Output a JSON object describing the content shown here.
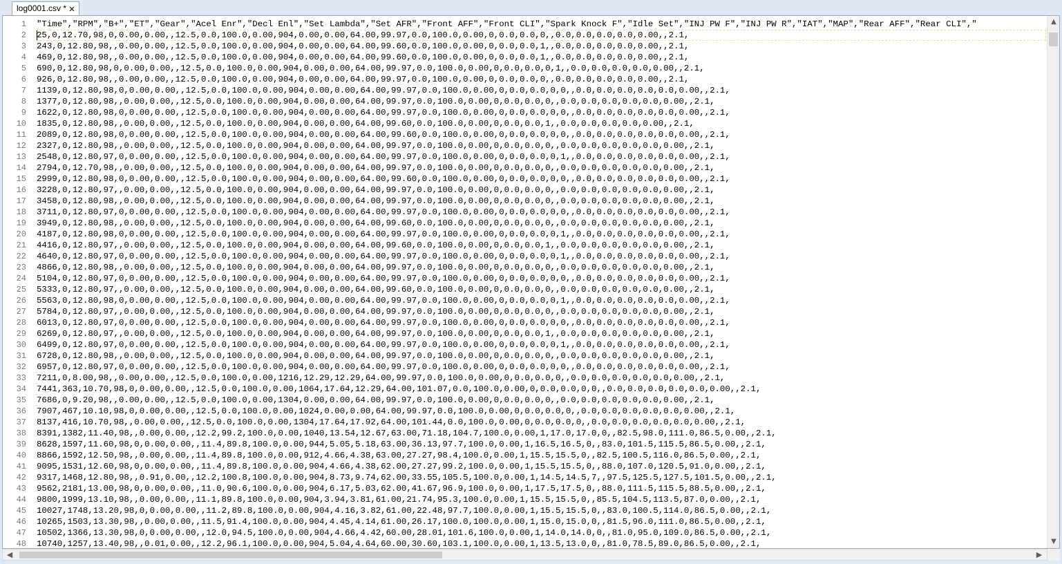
{
  "tab": {
    "title": "log0001.csv *",
    "close": "✕"
  },
  "colors": {
    "frame": "#dfe9f5",
    "editor_bg": "#ffffff",
    "line_number": "#7a7a7a",
    "current_line_border": "#f5e08a"
  },
  "icons": {
    "close": "close-icon",
    "up": "arrow-up-icon",
    "down": "arrow-down-icon",
    "left": "arrow-left-icon",
    "right": "arrow-right-icon"
  },
  "arrows": {
    "up": "▲",
    "down": "▼",
    "left": "◀",
    "right": "▶"
  },
  "lines": [
    {
      "n": "1",
      "t": "\"Time\",\"RPM\",\"B+\",\"ET\",\"Gear\",\"Acel Enr\",\"Decl Enl\",\"Set Lambda\",\"Set AFR\",\"Front AFF\",\"Front CLI\",\"Spark Knock F\",\"Idle Set\",\"INJ PW F\",\"INJ PW R\",\"IAT\",\"MAP\",\"Rear AFF\",\"Rear CLI\",\""
    },
    {
      "n": "2",
      "t": "25,0,12.70,98,0,0.00,0.00,,12.5,0.0,100.0,0.00,904,0.00,0.00,64.00,99.97,0.0,100.0,0.00,0,0.0,0.0,0,,0.0,0.0,0.0,0.0,0.00,,2.1,"
    },
    {
      "n": "3",
      "t": "243,0,12.80,98,,0.00,0.00,,12.5,0.0,100.0,0.00,904,0.00,0.00,64.00,99.60,0.0,100.0,0.00,0,0.0,0.0,1,,0.0,0.0,0.0,0.0,0.00,,2.1,"
    },
    {
      "n": "4",
      "t": "469,0,12.80,98,,0.00,0.00,,12.5,0.0,100.0,0.00,904,0.00,0.00,64.00,99.60,0.0,100.0,0.00,0,0.0,0.0,1,,0.0,0.0,0.0,0.0,0.00,,2.1,"
    },
    {
      "n": "5",
      "t": "690,0,12.80,98,0,0.00,0.00,,12.5,0.0,100.0,0.00,904,0.00,0.00,64.00,99.97,0.0,100.0,0.00,0,0.0,0.0,0,1,,0.0,0.0,0.0,0.0,0.00,,2.1,"
    },
    {
      "n": "6",
      "t": "926,0,12.80,98,,0.00,0.00,,12.5,0.0,100.0,0.00,904,0.00,0.00,64.00,99.97,0.0,100.0,0.00,0,0.0,0.0,0,,0.0,0.0,0.0,0.0,0.00,,2.1,"
    },
    {
      "n": "7",
      "t": "1139,0,12.80,98,0,0.00,0.00,,12.5,0.0,100.0,0.00,904,0.00,0.00,64.00,99.97,0.0,100.0,0.00,0,0.0,0.0,0,0,,0.0,0.0,0.0,0.0,0.0,0.00,,2.1,"
    },
    {
      "n": "8",
      "t": "1377,0,12.80,98,,0.00,0.00,,12.5,0.0,100.0,0.00,904,0.00,0.00,64.00,99.97,0.0,100.0,0.00,0,0.0,0.0,0,,0.0,0.0,0.0,0.0,0.0,0.00,,2.1,"
    },
    {
      "n": "9",
      "t": "1622,0,12.80,98,0,0.00,0.00,,12.5,0.0,100.0,0.00,904,0.00,0.00,64.00,99.97,0.0,100.0,0.00,0,0.0,0.0,0,0,,0.0,0.0,0.0,0.0,0.0,0.00,,2.1,"
    },
    {
      "n": "10",
      "t": "1835,0,12.80,98,,0.00,0.00,,12.5,0.0,100.0,0.00,904,0.00,0.00,64.00,99.60,0.0,100.0,0.00,0,0.0,0.0,1,,0.0,0.0,0.0,0.0,0.00,,2.1,"
    },
    {
      "n": "11",
      "t": "2089,0,12.80,98,0,0.00,0.00,,12.5,0.0,100.0,0.00,904,0.00,0.00,64.00,99.60,0.0,100.0,0.00,0,0.0,0.0,0,0,,0.0,0.0,0.0,0.0,0.0,0.00,,2.1,"
    },
    {
      "n": "12",
      "t": "2327,0,12.80,98,,0.00,0.00,,12.5,0.0,100.0,0.00,904,0.00,0.00,64.00,99.97,0.0,100.0,0.00,0,0.0,0.0,0,,0.0,0.0,0.0,0.0,0.0,0.00,,2.1,"
    },
    {
      "n": "13",
      "t": "2548,0,12.80,97,0,0.00,0.00,,12.5,0.0,100.0,0.00,904,0.00,0.00,64.00,99.97,0.0,100.0,0.00,0,0.0,0.0,0,1,,0.0,0.0,0.0,0.0,0.0,0.00,,2.1,"
    },
    {
      "n": "14",
      "t": "2794,0,12.70,98,,0.00,0.00,,12.5,0.0,100.0,0.00,904,0.00,0.00,64.00,99.97,0.0,100.0,0.00,0,0.0,0.0,0,,0.0,0.0,0.0,0.0,0.0,0.00,,2.1,"
    },
    {
      "n": "15",
      "t": "2999,0,12.80,98,0,0.00,0.00,,12.5,0.0,100.0,0.00,904,0.00,0.00,64.00,99.60,0.0,100.0,0.00,0,0.0,0.0,0,0,,0.0,0.0,0.0,0.0,0.0,0.00,,2.1,"
    },
    {
      "n": "16",
      "t": "3228,0,12.80,97,,0.00,0.00,,12.5,0.0,100.0,0.00,904,0.00,0.00,64.00,99.97,0.0,100.0,0.00,0,0.0,0.0,0,,0.0,0.0,0.0,0.0,0.0,0.00,,2.1,"
    },
    {
      "n": "17",
      "t": "3458,0,12.80,98,,0.00,0.00,,12.5,0.0,100.0,0.00,904,0.00,0.00,64.00,99.97,0.0,100.0,0.00,0,0.0,0.0,0,,0.0,0.0,0.0,0.0,0.0,0.00,,2.1,"
    },
    {
      "n": "18",
      "t": "3711,0,12.80,97,0,0.00,0.00,,12.5,0.0,100.0,0.00,904,0.00,0.00,64.00,99.97,0.0,100.0,0.00,0,0.0,0.0,0,0,,0.0,0.0,0.0,0.0,0.0,0.00,,2.1,"
    },
    {
      "n": "19",
      "t": "3949,0,12.80,98,,0.00,0.00,,12.5,0.0,100.0,0.00,904,0.00,0.00,64.00,99.60,0.0,100.0,0.00,0,0.0,0.0,0,,0.0,0.0,0.0,0.0,0.0,0.00,,2.1,"
    },
    {
      "n": "20",
      "t": "4187,0,12.80,98,0,0.00,0.00,,12.5,0.0,100.0,0.00,904,0.00,0.00,64.00,99.97,0.0,100.0,0.00,0,0.0,0.0,0,1,,0.0,0.0,0.0,0.0,0.0,0.00,,2.1,"
    },
    {
      "n": "21",
      "t": "4416,0,12.80,97,,0.00,0.00,,12.5,0.0,100.0,0.00,904,0.00,0.00,64.00,99.60,0.0,100.0,0.00,0,0.0,0.0,1,,0.0,0.0,0.0,0.0,0.0,0.00,,2.1,"
    },
    {
      "n": "22",
      "t": "4640,0,12.80,97,0,0.00,0.00,,12.5,0.0,100.0,0.00,904,0.00,0.00,64.00,99.97,0.0,100.0,0.00,0,0.0,0.0,0,1,,0.0,0.0,0.0,0.0,0.0,0.00,,2.1,"
    },
    {
      "n": "23",
      "t": "4866,0,12.80,98,,0.00,0.00,,12.5,0.0,100.0,0.00,904,0.00,0.00,64.00,99.97,0.0,100.0,0.00,0,0.0,0.0,0,,0.0,0.0,0.0,0.0,0.0,0.00,,2.1,"
    },
    {
      "n": "24",
      "t": "5104,0,12.80,97,0,0.00,0.00,,12.5,0.0,100.0,0.00,904,0.00,0.00,64.00,99.97,0.0,100.0,0.00,0,0.0,0.0,0,0,,0.0,0.0,0.0,0.0,0.0,0.00,,2.1,"
    },
    {
      "n": "25",
      "t": "5333,0,12.80,97,,0.00,0.00,,12.5,0.0,100.0,0.00,904,0.00,0.00,64.00,99.60,0.0,100.0,0.00,0,0.0,0.0,0,,0.0,0.0,0.0,0.0,0.0,0.00,,2.1,"
    },
    {
      "n": "26",
      "t": "5563,0,12.80,98,0,0.00,0.00,,12.5,0.0,100.0,0.00,904,0.00,0.00,64.00,99.97,0.0,100.0,0.00,0,0.0,0.0,0,1,,0.0,0.0,0.0,0.0,0.0,0.00,,2.1,"
    },
    {
      "n": "27",
      "t": "5784,0,12.80,97,,0.00,0.00,,12.5,0.0,100.0,0.00,904,0.00,0.00,64.00,99.97,0.0,100.0,0.00,0,0.0,0.0,0,,0.0,0.0,0.0,0.0,0.0,0.00,,2.1,"
    },
    {
      "n": "28",
      "t": "6013,0,12.80,97,0,0.00,0.00,,12.5,0.0,100.0,0.00,904,0.00,0.00,64.00,99.97,0.0,100.0,0.00,0,0.0,0.0,0,0,,0.0,0.0,0.0,0.0,0.0,0.00,,2.1,"
    },
    {
      "n": "29",
      "t": "6269,0,12.80,97,,0.00,0.00,,12.5,0.0,100.0,0.00,904,0.00,0.00,64.00,99.97,0.0,100.0,0.00,0,0.0,0.0,1,,0.0,0.0,0.0,0.0,0.0,0.00,,2.1,"
    },
    {
      "n": "30",
      "t": "6499,0,12.80,97,0,0.00,0.00,,12.5,0.0,100.0,0.00,904,0.00,0.00,64.00,99.97,0.0,100.0,0.00,0,0.0,0.0,0,1,,0.0,0.0,0.0,0.0,0.0,0.00,,2.1,"
    },
    {
      "n": "31",
      "t": "6728,0,12.80,98,,0.00,0.00,,12.5,0.0,100.0,0.00,904,0.00,0.00,64.00,99.97,0.0,100.0,0.00,0,0.0,0.0,0,,0.0,0.0,0.0,0.0,0.0,0.00,,2.1,"
    },
    {
      "n": "32",
      "t": "6957,0,12.80,97,0,0.00,0.00,,12.5,0.0,100.0,0.00,904,0.00,0.00,64.00,99.97,0.0,100.0,0.00,0,0.0,0.0,0,0,,0.0,0.0,0.0,0.0,0.0,0.00,,2.1,"
    },
    {
      "n": "33",
      "t": "7211,0,8.00,98,,0.00,0.00,,12.5,0.0,100.0,0.00,1216,12.29,12.29,64.00,99.97,0.0,100.0,0.00,0,0.0,0.0,0,,0.0,0.0,0.0,0.0,0.0,0.00,,2.1,"
    },
    {
      "n": "34",
      "t": "7441,363,10.70,98,0,0.00,0.00,,12.5,0.0,100.0,0.00,1064,17.64,12.29,64.00,101.07,0.0,100.0,0.00,0,0.0,0.0,0,0,,0.0,0.0,0.0,0.0,0.0,0.00,,2.1,"
    },
    {
      "n": "35",
      "t": "7686,0,9.20,98,,0.00,0.00,,12.5,0.0,100.0,0.00,1304,0.00,0.00,64.00,99.97,0.0,100.0,0.00,0,0.0,0.0,0,,0.0,0.0,0.0,0.0,0.0,0.00,,2.1,"
    },
    {
      "n": "36",
      "t": "7907,467,10.10,98,0,0.00,0.00,,12.5,0.0,100.0,0.00,1024,0.00,0.00,64.00,99.97,0.0,100.0,0.00,0,0.0,0.0,0,,0.0,0.0,0.0,0.0,0.0,0.00,,2.1,"
    },
    {
      "n": "37",
      "t": "8137,416,10.70,98,,0.00,0.00,,12.5,0.0,100.0,0.00,1304,17.64,17.92,64.00,101.44,0.0,100.0,0.00,0,0.0,0.0,0,,0.0,0.0,0.0,0.0,0.0,0.00,,2.1,"
    },
    {
      "n": "38",
      "t": "8391,1382,11.40,98,,0.00,0.00,,12.2,99.2,100.0,0.00,1040,13.54,12.67,63.00,71.18,104.7,100.0,0.00,1,17.0,17.0,0,,82.5,98.0,111.0,86.5,0.00,,2.1,"
    },
    {
      "n": "39",
      "t": "8628,1597,11.60,98,0,0.00,0.00,,11.4,89.8,100.0,0.00,944,5.05,5.18,63.00,36.13,97.7,100.0,0.00,1,16.5,16.5,0,,83.0,101.5,115.5,86.5,0.00,,2.1,"
    },
    {
      "n": "40",
      "t": "8866,1592,12.50,98,,0.00,0.00,,11.4,89.8,100.0,0.00,912,4.66,4.38,63.00,27.27,98.4,100.0,0.00,1,15.5,15.5,0,,82.5,100.5,116.0,86.5,0.00,,2.1,"
    },
    {
      "n": "41",
      "t": "9095,1531,12.60,98,0,0.00,0.00,,11.4,89.8,100.0,0.00,904,4.66,4.38,62.00,27.27,99.2,100.0,0.00,1,15.5,15.5,0,,88.0,107.0,120.5,91.0,0.00,,2.1,"
    },
    {
      "n": "42",
      "t": "9317,1468,12.80,98,,0.91,0.00,,12.2,100.8,100.0,0.00,904,8.73,9.74,62.00,33.55,105.5,100.0,0.00,1,14.5,14.5,7,,97.5,125.5,127.5,101.5,0.00,,2.1,"
    },
    {
      "n": "43",
      "t": "9562,2181,13.00,98,0,0.00,0.00,,11.0,90.6,100.0,0.00,904,6.17,5.03,62.00,41.67,96.9,100.0,0.00,1,17.5,17.5,0,,88.0,111.5,115.5,88.5,0.00,,2.1,"
    },
    {
      "n": "44",
      "t": "9800,1999,13.10,98,,0.00,0.00,,11.1,89.8,100.0,0.00,904,3.94,3.81,61.00,21.74,95.3,100.0,0.00,1,15.5,15.5,0,,85.5,104.5,113.5,87.0,0.00,,2.1,"
    },
    {
      "n": "45",
      "t": "10027,1748,13.20,98,0,0.00,0.00,,11.2,89.8,100.0,0.00,904,4.16,3.82,61.00,22.48,97.7,100.0,0.00,1,15.5,15.5,0,,83.0,100.5,114.0,86.5,0.00,,2.1,"
    },
    {
      "n": "46",
      "t": "10265,1503,13.30,98,,0.00,0.00,,11.5,91.4,100.0,0.00,904,4.45,4.14,61.00,26.17,100.0,100.0,0.00,1,15.0,15.0,0,,81.5,96.0,111.0,86.5,0.00,,2.1,"
    },
    {
      "n": "47",
      "t": "10502,1366,13.30,98,0,0.00,0.00,,12.0,94.5,100.0,0.00,904,4.66,4.42,60.00,28.01,101.6,100.0,0.00,1,14.0,14.0,0,,81.0,95.0,109.0,86.5,0.00,,2.1,"
    },
    {
      "n": "48",
      "t": "10740,1257,13.40,98,,0.01,0.00,,12.2,96.1,100.0,0.00,904,5.04,4.64,60.00,30.60,103.1,100.0,0.00,1,13.5,13.0,0,,81.0,78.5,89.0,86.5,0.00,,2.1,"
    }
  ]
}
